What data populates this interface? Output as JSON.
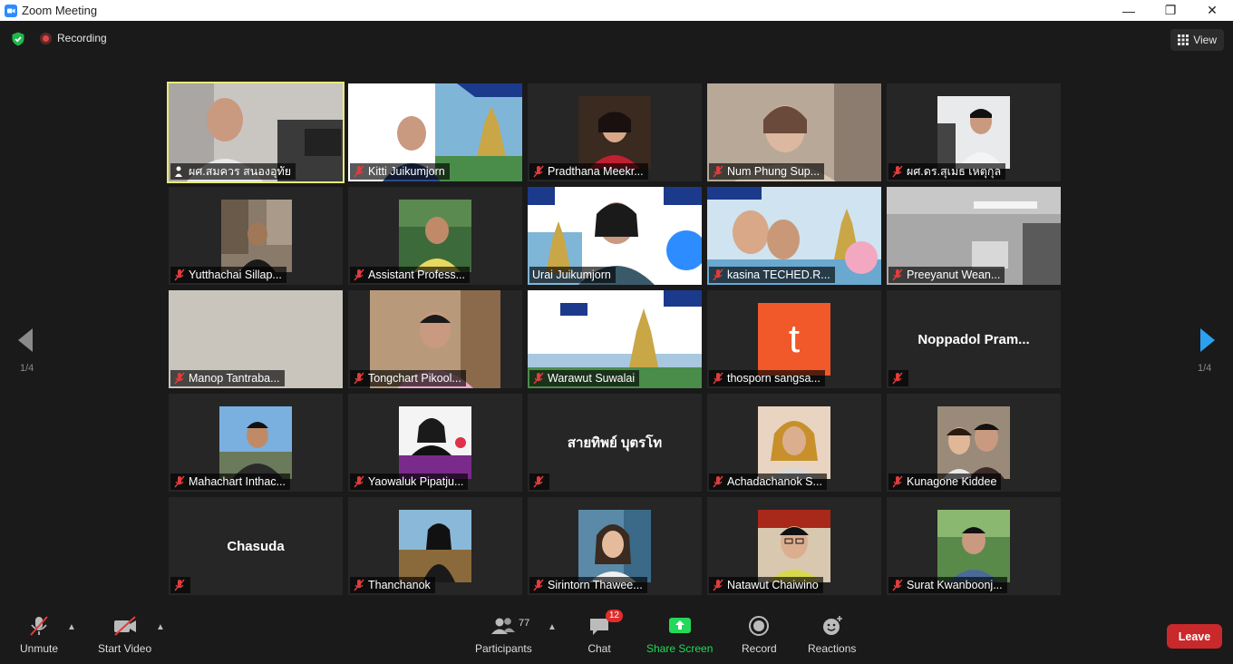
{
  "window": {
    "title": "Zoom Meeting",
    "minimize": "—",
    "maximize": "❐",
    "close": "✕"
  },
  "topbar": {
    "recording_label": "Recording",
    "view_label": "View"
  },
  "pagination": {
    "left_page": "1/4",
    "right_page": "1/4"
  },
  "tiles": [
    {
      "name": "ผศ.สมควร สนองอุทัย"
    },
    {
      "name": "Kitti Juikumjorn"
    },
    {
      "name": "Pradthana Meekr..."
    },
    {
      "name": "Num Phung Sup..."
    },
    {
      "name": "ผศ.ดร.สุเมธ เหตุกุล"
    },
    {
      "name": "Yutthachai Sillap..."
    },
    {
      "name": "Assistant Profess..."
    },
    {
      "name": "Urai Juikumjorn"
    },
    {
      "name": "kasina TECHED.R..."
    },
    {
      "name": "Preeyanut Wean..."
    },
    {
      "name": "Manop Tantraba..."
    },
    {
      "name": "Tongchart Pikool..."
    },
    {
      "name": "Warawut Suwalai"
    },
    {
      "name": "thosporn sangsa...",
      "avatar_letter": "t"
    },
    {
      "name": "",
      "big_name": "Noppadol  Pram..."
    },
    {
      "name": "Mahachart Inthac..."
    },
    {
      "name": "Yaowaluk Pipatju..."
    },
    {
      "name": "",
      "big_name": "สายทิพย์  บุตรโท"
    },
    {
      "name": "Achadachanok S..."
    },
    {
      "name": "Kunagone Kiddee"
    },
    {
      "name": "",
      "big_name": "Chasuda"
    },
    {
      "name": "Thanchanok"
    },
    {
      "name": "Sirintorn Thawee..."
    },
    {
      "name": "Natawut Chaiwino"
    },
    {
      "name": "Surat Kwanboonj..."
    }
  ],
  "toolbar": {
    "unmute": "Unmute",
    "start_video": "Start Video",
    "participants": "Participants",
    "participants_count": "77",
    "chat": "Chat",
    "chat_badge": "12",
    "share_screen": "Share Screen",
    "record": "Record",
    "reactions": "Reactions",
    "leave": "Leave"
  },
  "colors": {
    "share_green": "#23d959",
    "leave_red": "#c9292b",
    "active_speaker": "#e8ea7a",
    "avatar_orange": "#f1582a",
    "nav_blue": "#2da0ef"
  }
}
